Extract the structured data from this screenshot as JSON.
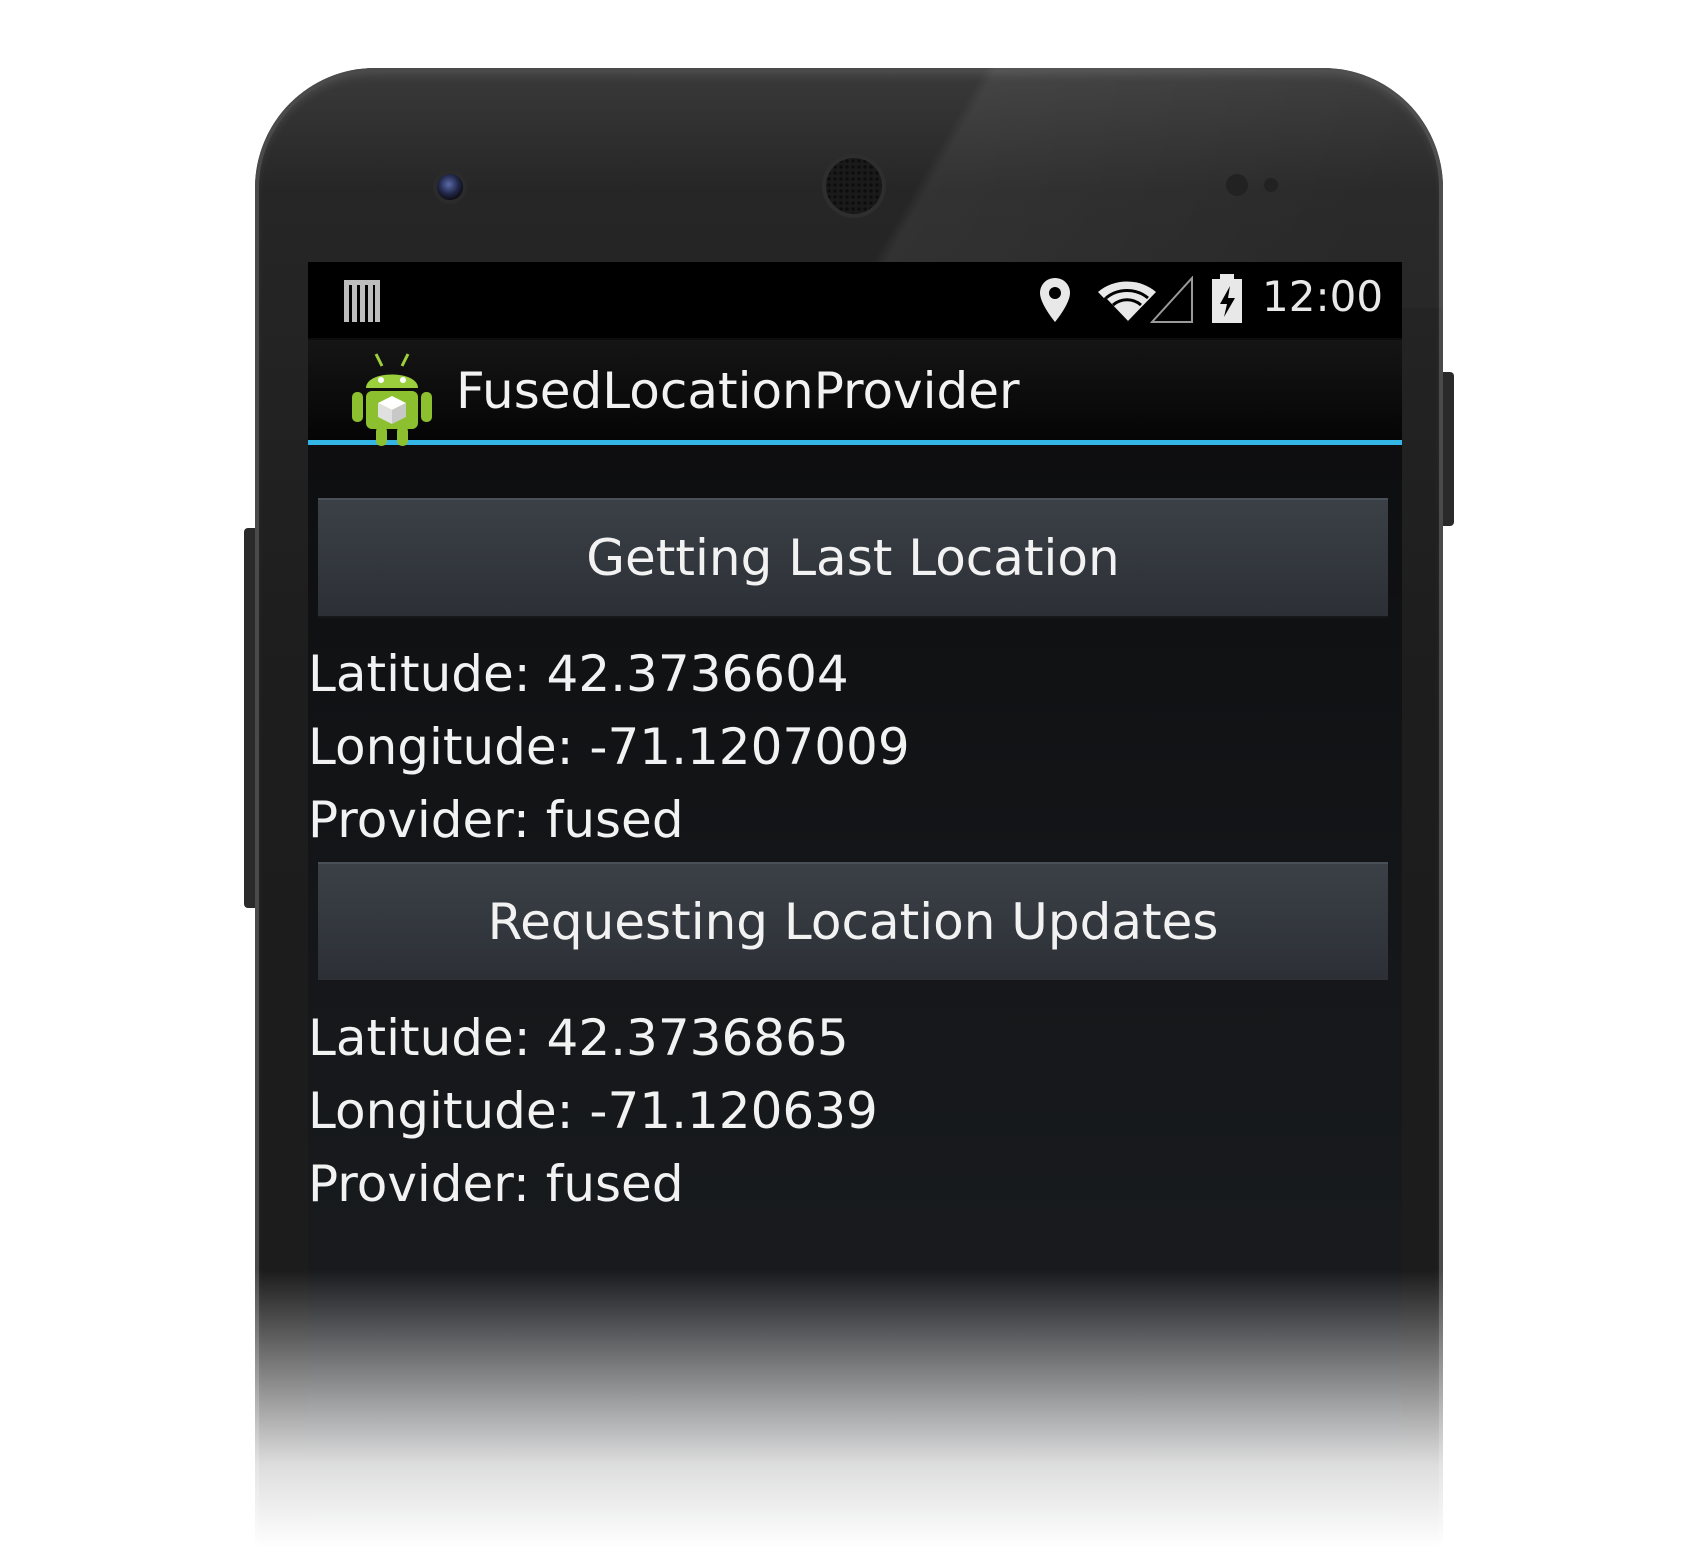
{
  "status_bar": {
    "time": "12:00",
    "icons": [
      "notification-bars-icon",
      "location-icon",
      "wifi-icon",
      "signal-icon",
      "battery-charging-icon"
    ]
  },
  "action_bar": {
    "app_title": "FusedLocationProvider",
    "app_icon": "android-robot-icon"
  },
  "main": {
    "last_location_button": "Getting Last Location",
    "last_location": {
      "latitude": "Latitude: 42.3736604",
      "longitude": "Longitude: -71.1207009",
      "provider": "Provider: fused"
    },
    "updates_button": "Requesting Location Updates",
    "updated_location": {
      "latitude": "Latitude: 42.3736865",
      "longitude": "Longitude: -71.120639",
      "provider": "Provider: fused"
    }
  },
  "colors": {
    "accent": "#33b5e5",
    "android_green": "#a4c639",
    "button_bg": "#33383e",
    "text": "#f2f2f2"
  }
}
